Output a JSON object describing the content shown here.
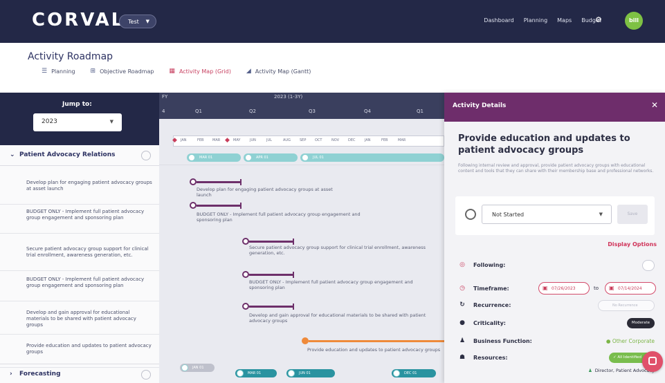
{
  "app": {
    "logo": "CORVAL",
    "environment": "Test",
    "nav": [
      "Dashboard",
      "Planning",
      "Maps",
      "Budget"
    ],
    "user_initials": "bill"
  },
  "page": {
    "title": "Activity Roadmap",
    "tabs": [
      {
        "label": "Planning",
        "icon": "list-icon"
      },
      {
        "label": "Objective Roadmap",
        "icon": "objective-icon"
      },
      {
        "label": "Activity Map (Grid)",
        "icon": "grid-icon",
        "active": true
      },
      {
        "label": "Activity Map (Gantt)",
        "icon": "gantt-icon"
      }
    ]
  },
  "sidebar": {
    "jump_label": "Jump to:",
    "jump_value": "2023",
    "groups": [
      {
        "label": "Patient Advocacy Relations",
        "expanded": true
      },
      {
        "label": "Forecasting",
        "expanded": false
      }
    ],
    "activities": [
      "Develop plan for engaging patient advocacy groups at asset launch",
      "BUDGET ONLY - Implement full patient advocacy group engagement and sponsoring plan",
      "Secure patient advocacy group support for clinical trial enrollment, awareness generation, etc.",
      "BUDGET ONLY - Implement full patient advocacy group engagement and sponsoring plan",
      "Develop and gain approval for educational materials to be shared with patient advocacy groups",
      "Provide education and updates to patient advocacy groups"
    ]
  },
  "grid": {
    "fy_labels": [
      "FY",
      "2023 (1-3Y)"
    ],
    "quarters": [
      "Q1",
      "Q2",
      "Q3",
      "Q4",
      "Q1"
    ],
    "months": [
      "JAN",
      "FEB",
      "MAR",
      "APR",
      "MAY",
      "JUN",
      "JUL",
      "AUG",
      "SEP",
      "OCT",
      "NOV",
      "DEC",
      "JAN",
      "FEB",
      "MAR"
    ],
    "milestones_top": [
      "MAR 01",
      "APR 01",
      "JUL 01"
    ],
    "milestones_bottom": [
      "JAN 01",
      "MAR 01",
      "JUN 01",
      "DEC 01"
    ],
    "bar_labels": [
      "Develop plan for engaging patient advocacy groups at asset launch",
      "BUDGET ONLY - Implement full patient advocacy group engagement and sponsoring plan",
      "Secure patient advocacy group support for clinical trial enrollment, awareness generation, etc.",
      "BUDGET ONLY - Implement full patient advocacy group engagement and sponsoring plan",
      "Develop and gain approval for educational materials to be shared with patient advocacy groups",
      "Provide education and updates to patient advocacy groups"
    ]
  },
  "details": {
    "header": "Activity Details",
    "title": "Provide education and updates to patient advocacy groups",
    "description": "Following internal review and approval, provide patient advocacy groups with educational content and tools that they can share with their membership base and professional networks.",
    "status": "Not Started",
    "save_label": "Save",
    "display_options": "Display Options",
    "fields": {
      "following": "Following:",
      "timeframe": "Timeframe:",
      "timeframe_start": "07/26/2023",
      "timeframe_to": "to",
      "timeframe_end": "07/14/2024",
      "recurrence": "Recurrence:",
      "recurrence_value": "No Recurrence",
      "criticality": "Criticality:",
      "criticality_value": "Moderate",
      "business_function": "Business Function:",
      "business_function_value": "Other Corporate",
      "resources": "Resources:",
      "resources_chip": "All Identified",
      "resources_owner": "Director, Patient Advocacy"
    },
    "colors": {
      "header": "#6e2d6b",
      "accent": "#c83c5a",
      "success": "#79bd4d"
    }
  }
}
